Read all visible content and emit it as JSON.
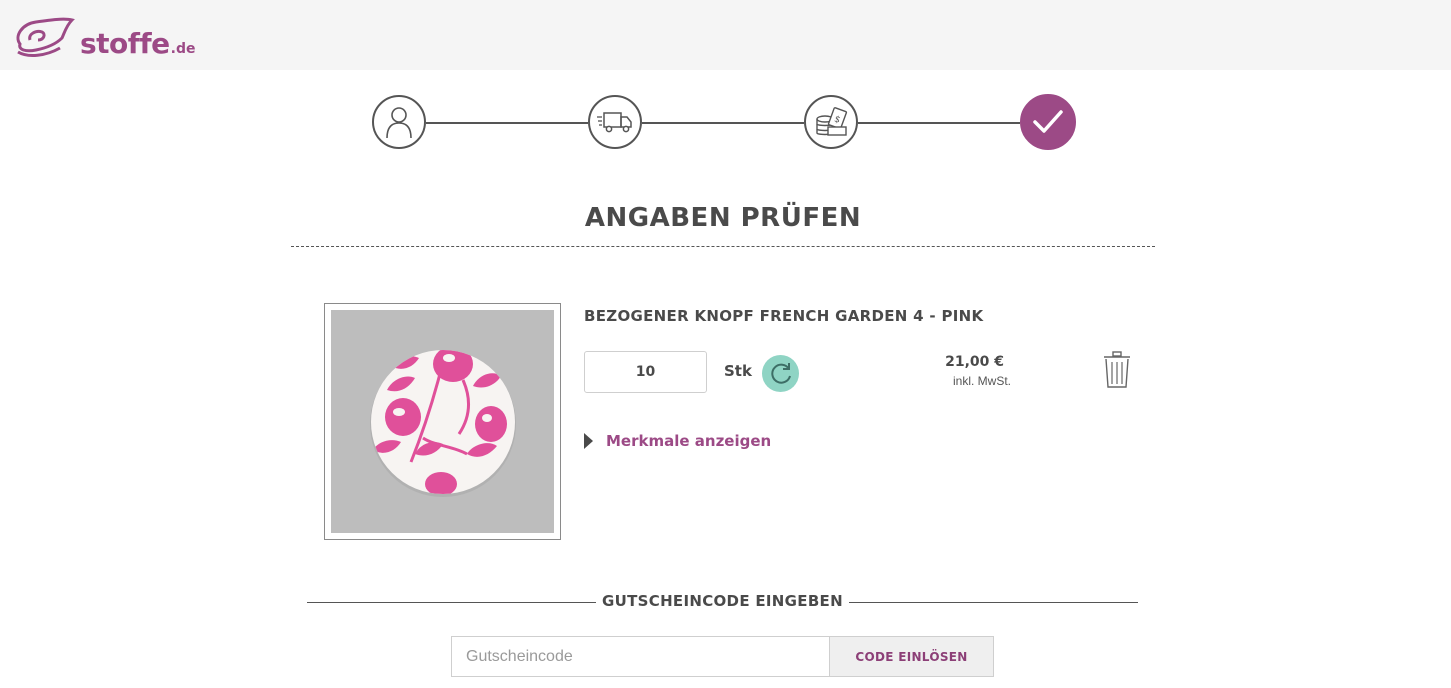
{
  "brand": {
    "name": "stoffe",
    "tld": ".de",
    "color": "#9c4a86"
  },
  "steps": [
    {
      "icon": "user-icon",
      "active": false
    },
    {
      "icon": "truck-icon",
      "active": false
    },
    {
      "icon": "payment-icon",
      "active": false
    },
    {
      "icon": "checkmark-icon",
      "active": true
    }
  ],
  "page": {
    "title": "ANGABEN PRÜFEN"
  },
  "cart_item": {
    "name": "BEZOGENER KNOPF FRENCH GARDEN 4 - PINK",
    "quantity": "10",
    "unit": "Stk",
    "price": "21,00 €",
    "price_note": "inkl. MwSt.",
    "features_label": "Merkmale anzeigen",
    "image_icon": "fabric-button-image",
    "refresh_color": "#8fd4c4"
  },
  "voucher": {
    "heading": "GUTSCHEINCODE EINGEBEN",
    "placeholder": "Gutscheincode",
    "button_label": "CODE EINLÖSEN"
  }
}
